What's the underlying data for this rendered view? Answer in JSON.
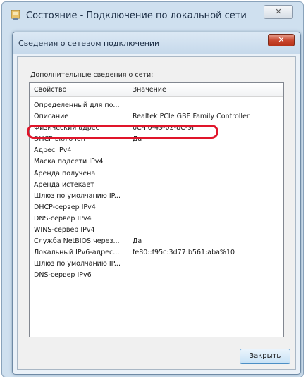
{
  "outer_window": {
    "title": "Состояние - Подключение по локальной сети",
    "close_label": "✕"
  },
  "dialog": {
    "title": "Сведения о сетевом подключении",
    "close_label": "✕",
    "section_label": "Дополнительные сведения о сети:",
    "columns": {
      "property": "Свойство",
      "value": "Значение"
    },
    "rows": [
      {
        "property": "Определенный для по...",
        "value": ""
      },
      {
        "property": "Описание",
        "value": "Realtek PCIe GBE Family Controller"
      },
      {
        "property": "Физический адрес",
        "value": "6C-F0-49-02-8C-9F"
      },
      {
        "property": "DHCP включен",
        "value": "Да"
      },
      {
        "property": "Адрес IPv4",
        "value": ""
      },
      {
        "property": "Маска подсети IPv4",
        "value": ""
      },
      {
        "property": "Аренда получена",
        "value": ""
      },
      {
        "property": "Аренда истекает",
        "value": ""
      },
      {
        "property": "Шлюз по умолчанию IP...",
        "value": ""
      },
      {
        "property": "DHCP-сервер IPv4",
        "value": ""
      },
      {
        "property": "DNS-сервер IPv4",
        "value": ""
      },
      {
        "property": "WINS-сервер IPv4",
        "value": ""
      },
      {
        "property": "Служба NetBIOS через...",
        "value": "Да"
      },
      {
        "property": "Локальный IPv6-адрес...",
        "value": "fe80::f95c:3d77:b561:aba%10"
      },
      {
        "property": "Шлюз по умолчанию IP...",
        "value": ""
      },
      {
        "property": "DNS-сервер IPv6",
        "value": ""
      }
    ],
    "highlight_color": "#e0152a",
    "close_button_label": "Закрыть"
  }
}
